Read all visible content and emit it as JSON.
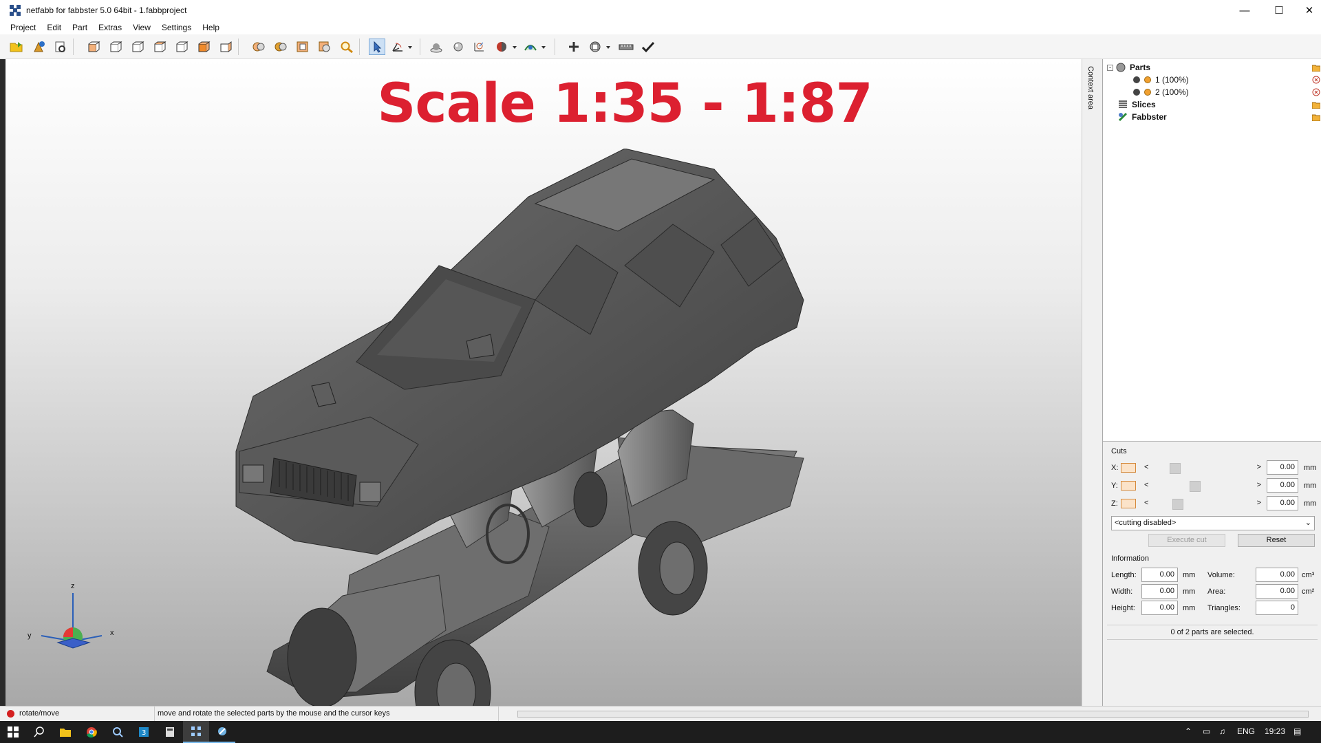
{
  "window": {
    "title": "netfabb for fabbster 5.0 64bit - 1.fabbproject"
  },
  "menu": [
    "Project",
    "Edit",
    "Part",
    "Extras",
    "View",
    "Settings",
    "Help"
  ],
  "toolbar": {
    "icons": [
      "open-project-icon",
      "add-part-icon",
      "export-icon",
      "view-front-icon",
      "view-back-icon",
      "view-left-icon",
      "view-right-icon",
      "view-top-icon",
      "view-bottom-icon",
      "view-perspective-icon",
      "zoom-all-icon",
      "zoom-selection-icon",
      "zoom-window-icon",
      "zoom-part-icon",
      "zoom-icon",
      "select-pointer-icon",
      "rotate-move-icon",
      "shading-icon",
      "light-icon",
      "transform-icon",
      "color-icon",
      "analysis-icon",
      "add-icon",
      "boolean-icon",
      "measure-icon",
      "check-icon"
    ]
  },
  "viewport": {
    "scale_text": "Scale 1:35 - 1:87",
    "axes": {
      "x": "x",
      "y": "y",
      "z": "z"
    }
  },
  "context_area": {
    "label": "Context area"
  },
  "tree": {
    "parts_label": "Parts",
    "parts": [
      "1 (100%)",
      "2 (100%)"
    ],
    "slices_label": "Slices",
    "fabbster_label": "Fabbster"
  },
  "cuts": {
    "title": "Cuts",
    "axes": [
      {
        "label": "X:",
        "value": "0.00",
        "unit": "mm",
        "position": 0.2
      },
      {
        "label": "Y:",
        "value": "0.00",
        "unit": "mm",
        "position": 0.42
      },
      {
        "label": "Z:",
        "value": "0.00",
        "unit": "mm",
        "position": 0.23
      }
    ],
    "arrow_left": "<",
    "arrow_right": ">",
    "mode": "<cutting disabled>",
    "execute_label": "Execute cut",
    "reset_label": "Reset"
  },
  "information": {
    "title": "Information",
    "length_label": "Length:",
    "length": "0.00",
    "width_label": "Width:",
    "width": "0.00",
    "height_label": "Height:",
    "height": "0.00",
    "unit_mm": "mm",
    "volume_label": "Volume:",
    "volume": "0.00",
    "volume_unit": "cm³",
    "area_label": "Area:",
    "area": "0.00",
    "area_unit": "cm²",
    "triangles_label": "Triangles:",
    "triangles": "0",
    "selection_text": "0 of 2 parts are selected."
  },
  "status": {
    "mode": "rotate/move",
    "hint": "move and rotate the selected parts by the mouse and the cursor keys"
  },
  "taskbar": {
    "language": "ENG",
    "time": "19:23"
  },
  "colors": {
    "accent": "#dc2030",
    "car": "#5a5a5a",
    "taskbar": "#1d1d1d"
  }
}
